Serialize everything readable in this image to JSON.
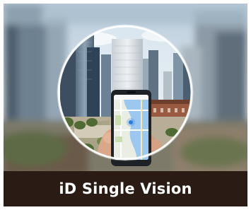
{
  "product": {
    "caption": "iD Single Vision"
  },
  "hero_image": {
    "icon": "lens-city-phone-illustration"
  },
  "colors": {
    "caption_bar": "#2a1b14",
    "caption_text": "#ffffff",
    "lens_ring": "#ffffff",
    "sky": "#cfdde8",
    "map_water": "#9cc7ee",
    "map_land": "#e9ede4"
  }
}
